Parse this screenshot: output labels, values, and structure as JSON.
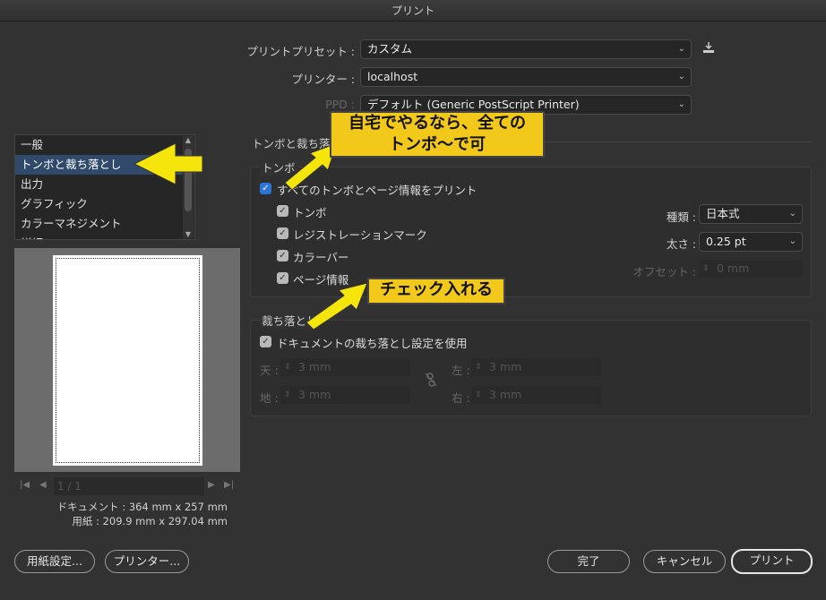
{
  "window": {
    "title": "プリント"
  },
  "preset": {
    "label": "プリントプリセット :",
    "value": "カスタム"
  },
  "printer": {
    "label": "プリンター :",
    "value": "localhost"
  },
  "ppd": {
    "label": "PPD :",
    "value": "デフォルト (Generic PostScript Printer)"
  },
  "sidebar": {
    "items": [
      {
        "label": "一般"
      },
      {
        "label": "トンボと裁ち落とし"
      },
      {
        "label": "出力"
      },
      {
        "label": "グラフィック"
      },
      {
        "label": "カラーマネジメント"
      },
      {
        "label": "詳細"
      }
    ]
  },
  "preview": {
    "page_field": "1 / 1",
    "document_size": "ドキュメント : 364 mm x 257 mm",
    "paper_size": "用紙 : 209.9 mm x 297.04 mm"
  },
  "section": {
    "title": "トンボと裁ち落とし"
  },
  "marks": {
    "title": "トンボ",
    "all_marks": "すべてのトンボとページ情報をプリント",
    "trim": "トンボ",
    "registration": "レジストレーションマーク",
    "color_bars": "カラーバー",
    "page_info": "ページ情報",
    "type_label": "種類 :",
    "type_value": "日本式",
    "weight_label": "太さ :",
    "weight_value": "0.25 pt",
    "offset_label": "オフセット :",
    "offset_value": "0 mm"
  },
  "bleed": {
    "title": "裁ち落とし",
    "use_doc": "ドキュメントの裁ち落とし設定を使用",
    "top_label": "天 :",
    "top_value": "3 mm",
    "bottom_label": "地 :",
    "bottom_value": "3 mm",
    "left_label": "左 :",
    "left_value": "3 mm",
    "right_label": "右 :",
    "right_value": "3 mm"
  },
  "buttons": {
    "page_setup": "用紙設定...",
    "printer": "プリンター...",
    "done": "完了",
    "cancel": "キャンセル",
    "print": "プリント"
  },
  "annotations": {
    "callout1_line1": "自宅でやるなら、全ての",
    "callout1_line2": "トンボ〜で可",
    "callout2": "チェック入れる",
    "arrow_color": "#f5e50a"
  }
}
